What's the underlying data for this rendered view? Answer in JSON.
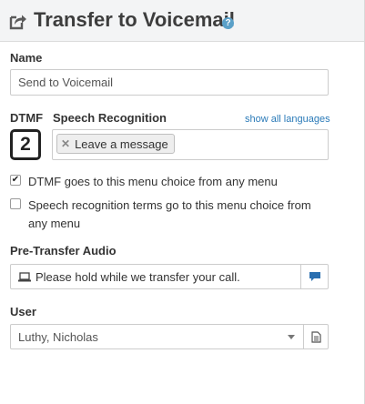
{
  "header": {
    "title": "Transfer to Voicemail",
    "icon": "share-icon",
    "help_icon": "?"
  },
  "name": {
    "label": "Name",
    "value": "Send to Voicemail"
  },
  "dtmf": {
    "label": "DTMF",
    "value": "2"
  },
  "speech": {
    "label": "Speech Recognition",
    "show_all_link": "show all languages",
    "tags": [
      "Leave a message"
    ]
  },
  "options": [
    {
      "label": "DTMF goes to this menu choice from any menu",
      "checked": true
    },
    {
      "label": "Speech recognition terms go to this menu choice from any menu",
      "checked": false
    }
  ],
  "pretransfer": {
    "label": "Pre-Transfer Audio",
    "value": "Please hold while we transfer your call.",
    "prefix_icon": "laptop-icon",
    "action_icon": "chat-icon"
  },
  "user": {
    "label": "User",
    "selected": "Luthy, Nicholas",
    "action_icon": "document-icon"
  },
  "colors": {
    "link": "#2a7ab8",
    "header_bg": "#f3f4f5",
    "help": "#5aa0c8"
  }
}
